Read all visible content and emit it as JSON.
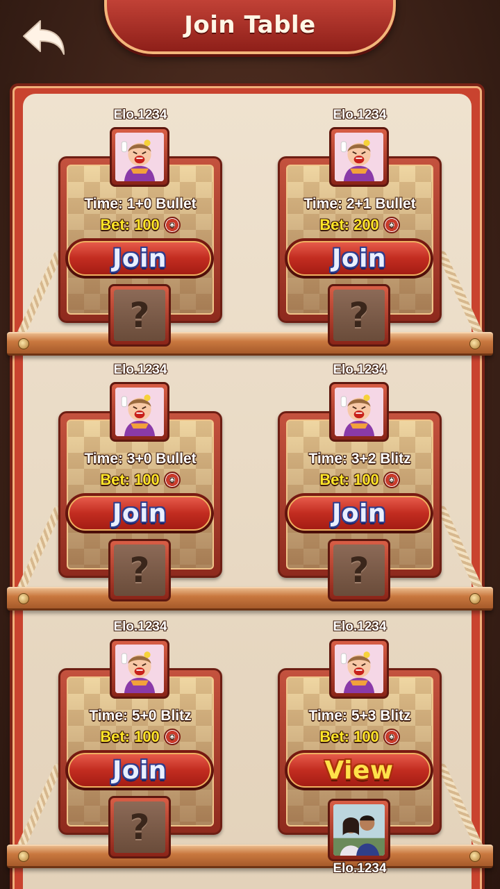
{
  "header": {
    "title": "Join Table"
  },
  "icons": {
    "back": "back-arrow-icon",
    "chip": "poker-chip-icon",
    "unknown": "question-mark-icon"
  },
  "colors": {
    "bet_text": "#ffe628",
    "join_label": "#e9efff",
    "view_label": "#ffe24a",
    "button_red": "#c22c20"
  },
  "tables": [
    {
      "elo": "Elo.1234",
      "time": "Time: 1+0 Bullet",
      "bet": "Bet: 100",
      "action": "Join",
      "opponent": "?"
    },
    {
      "elo": "Elo.1234",
      "time": "Time: 2+1 Bullet",
      "bet": "Bet: 200",
      "action": "Join",
      "opponent": "?"
    },
    {
      "elo": "Elo.1234",
      "time": "Time: 3+0 Bullet",
      "bet": "Bet: 100",
      "action": "Join",
      "opponent": "?"
    },
    {
      "elo": "Elo.1234",
      "time": "Time: 3+2 Blitz",
      "bet": "Bet: 100",
      "action": "Join",
      "opponent": "?"
    },
    {
      "elo": "Elo.1234",
      "time": "Time: 5+0 Blitz",
      "bet": "Bet: 100",
      "action": "Join",
      "opponent": "?"
    },
    {
      "elo": "Elo.1234",
      "time": "Time: 5+3 Blitz",
      "bet": "Bet: 100",
      "action": "View",
      "opponent_elo": "Elo.1234"
    }
  ]
}
